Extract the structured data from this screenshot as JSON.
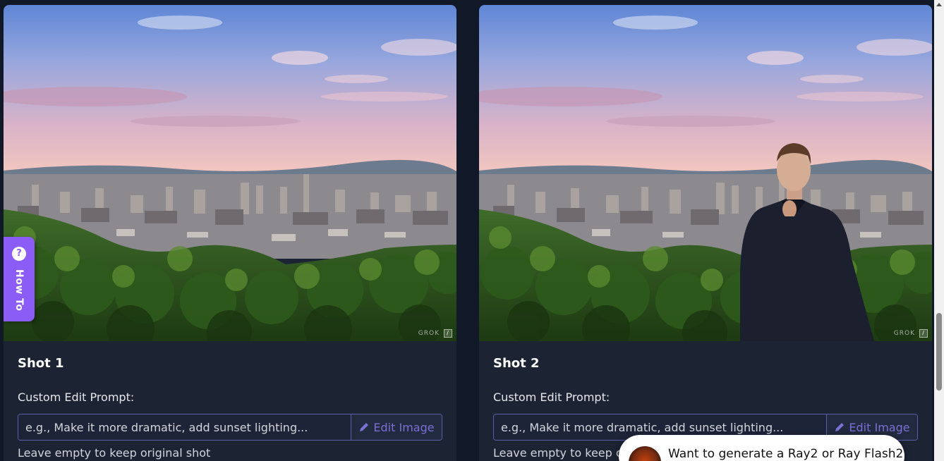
{
  "shots": [
    {
      "title": "Shot 1",
      "prompt_label": "Custom Edit Prompt:",
      "prompt_placeholder": "e.g., Make it more dramatic, add sunset lighting...",
      "edit_button_label": "Edit Image",
      "hint": "Leave empty to keep original shot",
      "watermark": "GROK",
      "has_person": false
    },
    {
      "title": "Shot 2",
      "prompt_label": "Custom Edit Prompt:",
      "prompt_placeholder": "e.g., Make it more dramatic, add sunset lighting...",
      "edit_button_label": "Edit Image",
      "hint": "Leave empty to keep o",
      "watermark": "GROK",
      "has_person": true
    }
  ],
  "howto": {
    "label": "How To",
    "icon": "?"
  },
  "chat_popup": {
    "text": "Want to generate a Ray2 or Ray Flash2"
  },
  "colors": {
    "page_bg": "#111827",
    "card_bg": "#1c2333",
    "accent": "#8b5cf6",
    "edit_button_text": "#7c6fd6",
    "input_border": "#5b5fa8"
  },
  "icons": {
    "edit_button": "pencil-icon",
    "howto": "question-mark-icon",
    "watermark": "edit-square-icon"
  }
}
